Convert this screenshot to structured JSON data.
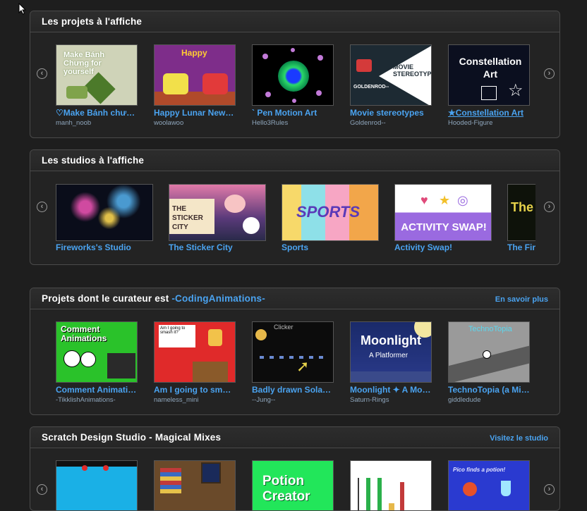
{
  "section_projects": {
    "title": "Les projets à l'affiche",
    "items": [
      {
        "title": "♡Make Bánh chưng for yourself",
        "author": "manh_noob",
        "thumb_text": "Make Bánh Chưng for yourself"
      },
      {
        "title": "Happy Lunar New Year",
        "author": "woolawoo",
        "thumb_text": "Happy"
      },
      {
        "title": "` Pen Motion Art",
        "author": "Hello3Rules",
        "thumb_text": ""
      },
      {
        "title": "Movie stereotypes",
        "author": "Goldenrod--",
        "thumb_text": "MOVIE STEREOTYPES",
        "thumb_sub": "GOLDENROD--"
      },
      {
        "title": "★Constellation Art",
        "author": "Hooded-Figure",
        "thumb_text": "Constellation Art"
      }
    ]
  },
  "section_studios": {
    "title": "Les studios à l'affiche",
    "items": [
      {
        "title": "Fireworks's Studio"
      },
      {
        "title": "The Sticker City",
        "thumb_text": "THE STICKER CITY"
      },
      {
        "title": "Sports",
        "thumb_text": "SPORTS"
      },
      {
        "title": "Activity Swap!",
        "thumb_text": "ACTIVITY SWAP!"
      },
      {
        "title": "The Fire",
        "thumb_text": "The"
      }
    ]
  },
  "section_curator": {
    "title_prefix": "Projets dont le curateur est ",
    "curator": "-CodingAnimations-",
    "link": "En savoir plus",
    "items": [
      {
        "title": "Comment Animations",
        "author": "-TikklishAnimations-",
        "thumb_text": "Comment Animations"
      },
      {
        "title": "Am I going to smash it?",
        "author": "nameless_mini",
        "thumb_text": "Am I going to smash it?"
      },
      {
        "title": "Badly drawn Solar System",
        "author": "--Jung--",
        "thumb_text": "Clicker"
      },
      {
        "title": "Moonlight ✦ A Moonlit Platformer",
        "author": "Saturn-Rings",
        "thumb_text": "Moonlight",
        "thumb_sub": "A Platformer"
      },
      {
        "title": "TechnoTopia (a Mini game)",
        "author": "giddledude",
        "thumb_text": "TechnoTopia"
      }
    ]
  },
  "section_studio": {
    "title": "Scratch Design Studio - Magical Mixes",
    "link": "Visitez le studio",
    "thumb_texts": [
      "",
      "",
      "Potion Creator",
      "",
      "Pico finds a potion!"
    ]
  },
  "colors": {
    "accent": "#4aa3f0",
    "background": "#1e1e1e",
    "panel": "#232323"
  },
  "icons": {
    "prev": "arrow-left-circle",
    "next": "arrow-right-circle"
  }
}
